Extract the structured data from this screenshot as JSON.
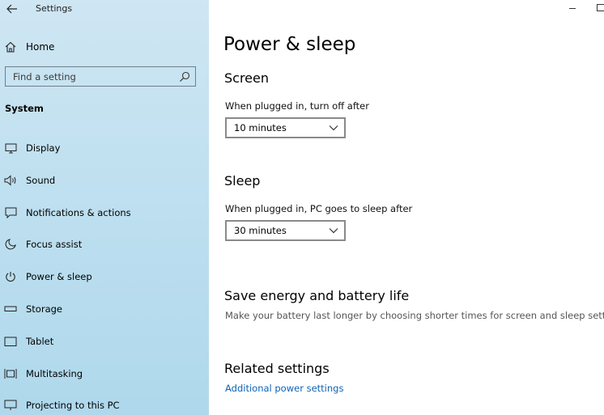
{
  "app_title": "Settings",
  "home_label": "Home",
  "search": {
    "placeholder": "Find a setting"
  },
  "section": "System",
  "nav": [
    {
      "label": "Display",
      "icon": "display-icon"
    },
    {
      "label": "Sound",
      "icon": "sound-icon"
    },
    {
      "label": "Notifications & actions",
      "icon": "notifications-icon"
    },
    {
      "label": "Focus assist",
      "icon": "focus-assist-icon"
    },
    {
      "label": "Power & sleep",
      "icon": "power-icon"
    },
    {
      "label": "Storage",
      "icon": "storage-icon"
    },
    {
      "label": "Tablet",
      "icon": "tablet-icon"
    },
    {
      "label": "Multitasking",
      "icon": "multitasking-icon"
    },
    {
      "label": "Projecting to this PC",
      "icon": "projecting-icon"
    }
  ],
  "main": {
    "title": "Power & sleep",
    "screen": {
      "heading": "Screen",
      "label": "When plugged in, turn off after",
      "value": "10 minutes"
    },
    "sleep": {
      "heading": "Sleep",
      "label": "When plugged in, PC goes to sleep after",
      "value": "30 minutes"
    },
    "save_energy": {
      "heading": "Save energy and battery life",
      "description": "Make your battery last longer by choosing shorter times for screen and sleep settings."
    },
    "related": {
      "heading": "Related settings",
      "link": "Additional power settings"
    }
  },
  "colors": {
    "sidebar": "#bfe0f0",
    "link": "#0b63b6"
  }
}
